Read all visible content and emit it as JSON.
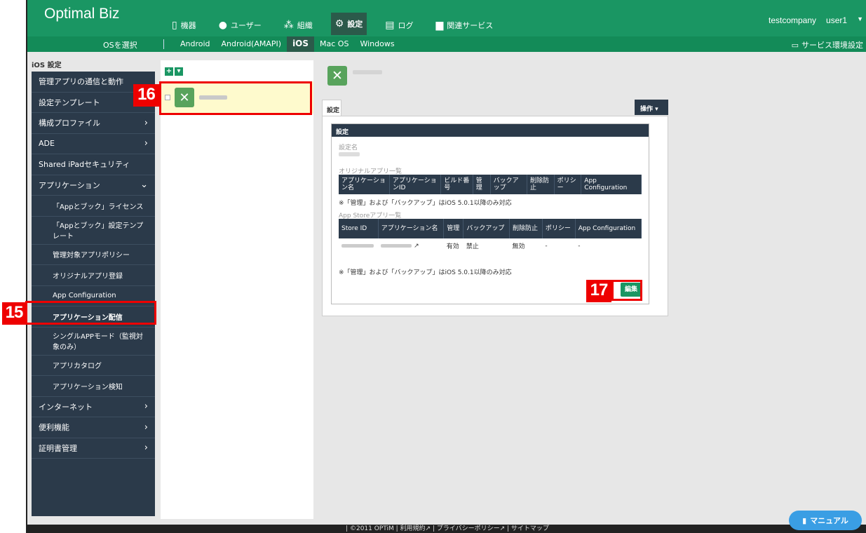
{
  "header": {
    "brand": "Optimal Biz",
    "nav": [
      {
        "icon": "device-icon",
        "glyph": "▯",
        "label": "機器"
      },
      {
        "icon": "user-icon",
        "glyph": "●",
        "label": "ユーザー"
      },
      {
        "icon": "org-icon",
        "glyph": "⁂",
        "label": "組織"
      },
      {
        "icon": "gear-icon",
        "glyph": "⚙",
        "label": "設定"
      },
      {
        "icon": "document-icon",
        "glyph": "▤",
        "label": "ログ"
      },
      {
        "icon": "folder-icon",
        "glyph": "▆",
        "label": "関連サービス"
      }
    ],
    "company": "testcompany",
    "user": "user1"
  },
  "subbar": {
    "os_select": "OSを選択",
    "os_tabs": [
      "Android",
      "Android(AMAPI)",
      "iOS",
      "Mac OS",
      "Windows"
    ],
    "service_env": "サービス環境設定"
  },
  "sidebar": {
    "title": "iOS 設定",
    "items": [
      {
        "label": "管理アプリの通信と動作",
        "chev": ""
      },
      {
        "label": "設定テンプレート",
        "chev": ""
      },
      {
        "label": "構成プロファイル",
        "chev": "›"
      },
      {
        "label": "ADE",
        "chev": "›"
      },
      {
        "label": "Shared iPadセキュリティ",
        "chev": ""
      },
      {
        "label": "アプリケーション",
        "chev": "⌄"
      },
      {
        "label": "「Appとブック」ライセンス",
        "chev": ""
      },
      {
        "label": "「Appとブック」設定テンプレート",
        "chev": ""
      },
      {
        "label": "管理対象アプリポリシー",
        "chev": ""
      },
      {
        "label": "オリジナルアプリ登録",
        "chev": ""
      },
      {
        "label": "App Configuration",
        "chev": ""
      },
      {
        "label": "アプリケーション配信",
        "chev": ""
      },
      {
        "label": "シングルAPPモード（監視対象のみ）",
        "chev": ""
      },
      {
        "label": "アプリカタログ",
        "chev": ""
      },
      {
        "label": "アプリケーション検知",
        "chev": ""
      },
      {
        "label": "インターネット",
        "chev": "›"
      },
      {
        "label": "便利機能",
        "chev": "›"
      },
      {
        "label": "証明書管理",
        "chev": "›"
      }
    ]
  },
  "badges": {
    "b15": "15",
    "b16": "16",
    "b17": "17"
  },
  "detail": {
    "tab": "設定",
    "operation": "操作 ▾",
    "card_title": "設定",
    "name_label": "設定名",
    "original_label": "オリジナルアプリ一覧",
    "original_headers": [
      "アプリケーション名",
      "アプリケーションID",
      "ビルド番号",
      "管理",
      "バックアップ",
      "削除防止",
      "ポリシー",
      "App Configuration"
    ],
    "note": "※「管理」および「バックアップ」はiOS 5.0.1以降のみ対応",
    "appstore_label": "App Storeアプリ一覧",
    "appstore_headers": [
      "Store ID",
      "アプリケーション名",
      "管理",
      "バックアップ",
      "削除防止",
      "ポリシー",
      "App Configuration"
    ],
    "appstore_row": [
      "",
      "",
      "有効",
      "禁止",
      "無効",
      "-",
      "-"
    ],
    "edit": "編集"
  },
  "footer": "| ©2011 OPTiM | 利用規約↗ | プライバシーポリシー↗ | サイトマップ",
  "manual": "マニュアル",
  "colors": {
    "green": "#1a9663",
    "navy": "#2b3a4a",
    "highlight": "#e00000"
  }
}
